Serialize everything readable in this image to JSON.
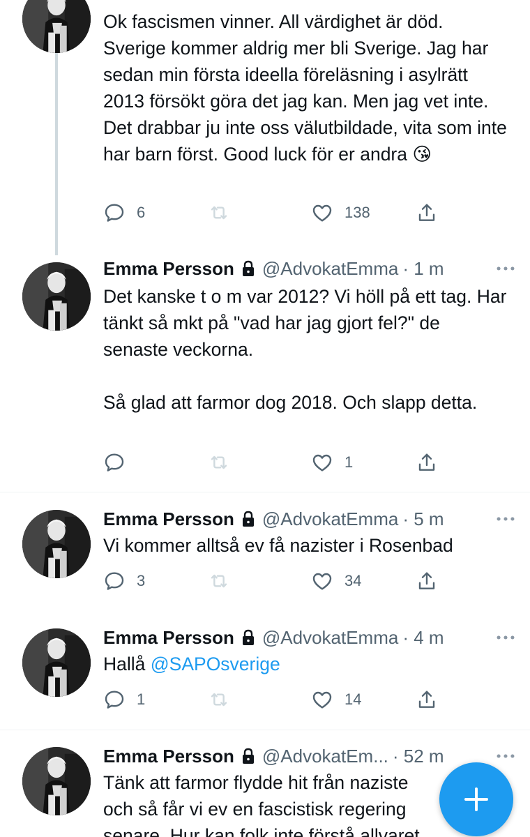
{
  "tweets": [
    {
      "text": "Ok fascismen vinner. All värdighet är död. Sverige kommer aldrig mer bli Sverige. Jag har sedan min första ideella föreläsning i asylrätt 2013 försökt göra det jag kan. Men jag vet inte. Det drabbar ju inte oss välutbildade, vita som inte har barn först. Good luck för er andra 😘",
      "replies": "6",
      "retweets": "",
      "likes": "138"
    },
    {
      "name": "Emma Persson",
      "handle": "@AdvokatEmma",
      "time": "· 1 m",
      "text": "Det kanske t o m var 2012? Vi höll på ett tag. Har tänkt så mkt på \"vad har jag gjort fel?\" de senaste veckorna.\n\nSå glad att farmor dog 2018. Och slapp detta.",
      "replies": "",
      "retweets": "",
      "likes": "1"
    },
    {
      "name": "Emma Persson",
      "handle": "@AdvokatEmma",
      "time": "· 5 m",
      "text": "Vi kommer alltså ev få nazister i Rosenbad",
      "replies": "3",
      "retweets": "",
      "likes": "34"
    },
    {
      "name": "Emma Persson",
      "handle": "@AdvokatEmma",
      "time": "· 4 m",
      "text_prefix": "Hallå ",
      "mention": "@SAPOsverige",
      "replies": "1",
      "retweets": "",
      "likes": "14"
    },
    {
      "name": "Emma Persson",
      "handle": "@AdvokatEm...",
      "time": "· 52 m",
      "text": "Tänk att farmor flydde hit från naziste\noch så får vi ev en fascistisk regering\nsenare. Hur kan folk inte förstå allvaret",
      "replies": "",
      "retweets": "",
      "likes": ""
    }
  ],
  "icons": {
    "reply": "reply-icon",
    "retweet": "retweet-icon",
    "like": "heart-icon",
    "share": "share-icon",
    "more": "more-icon",
    "lock": "lock-icon",
    "compose": "plus-icon"
  },
  "colors": {
    "accent": "#1d9bf0",
    "secondary_text": "#536471",
    "thread_line": "#cfd9de"
  }
}
